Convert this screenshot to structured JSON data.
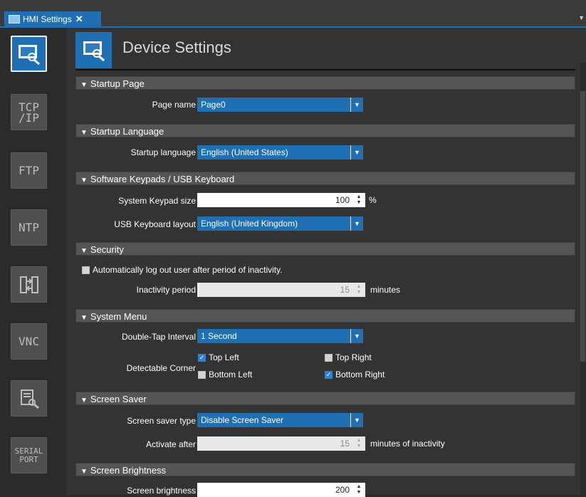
{
  "tab": {
    "title": "HMI Settings",
    "close": "✕"
  },
  "nav": {
    "items": [
      {
        "name": "nav-device-settings",
        "label": "",
        "icon": "monitor-search-icon",
        "active": true
      },
      {
        "name": "nav-tcpip",
        "label": "TCP\n/IP"
      },
      {
        "name": "nav-ftp",
        "label": "FTP"
      },
      {
        "name": "nav-ntp",
        "label": "NTP"
      },
      {
        "name": "nav-transfer",
        "label": "",
        "icon": "transfer-icon"
      },
      {
        "name": "nav-vnc",
        "label": "VNC"
      },
      {
        "name": "nav-diagnostics",
        "label": "",
        "icon": "diagnostics-icon"
      },
      {
        "name": "nav-serial-port",
        "label": "SERIAL\nPORT"
      }
    ]
  },
  "header": {
    "title": "Device Settings"
  },
  "sections": {
    "startup_page": "Startup Page",
    "startup_language": "Startup Language",
    "keypads": "Software Keypads / USB Keyboard",
    "security": "Security",
    "system_menu": "System Menu",
    "screen_saver": "Screen Saver",
    "brightness": "Screen Brightness"
  },
  "fields": {
    "page_name": {
      "label": "Page name",
      "value": "Page0"
    },
    "startup_language": {
      "label": "Startup language",
      "value": "English (United States)"
    },
    "keypad_size": {
      "label": "System Keypad size",
      "value": "100",
      "unit": "%"
    },
    "usb_layout": {
      "label": "USB Keyboard layout",
      "value": "English (United Kingdom)"
    },
    "auto_logout": {
      "label": "Automatically log out user after period of inactivity.",
      "checked": false
    },
    "inactivity": {
      "label": "Inactivity period",
      "value": "15",
      "unit": "minutes"
    },
    "double_tap": {
      "label": "Double-Tap Interval",
      "value": "1 Second"
    },
    "detectable_corner": {
      "label": "Detectable Corner",
      "top_left": {
        "label": "Top Left",
        "checked": true
      },
      "top_right": {
        "label": "Top Right",
        "checked": false
      },
      "bottom_left": {
        "label": "Bottom Left",
        "checked": false
      },
      "bottom_right": {
        "label": "Bottom Right",
        "checked": true
      }
    },
    "saver_type": {
      "label": "Screen saver type",
      "value": "Disable Screen Saver"
    },
    "activate_after": {
      "label": "Activate after",
      "value": "15",
      "unit": "minutes of inactivity"
    },
    "brightness": {
      "label": "Screen brightness",
      "value": "200"
    }
  },
  "colors": {
    "accent": "#1f6fb2",
    "section_bg": "#555555",
    "panel_bg": "#333333"
  }
}
